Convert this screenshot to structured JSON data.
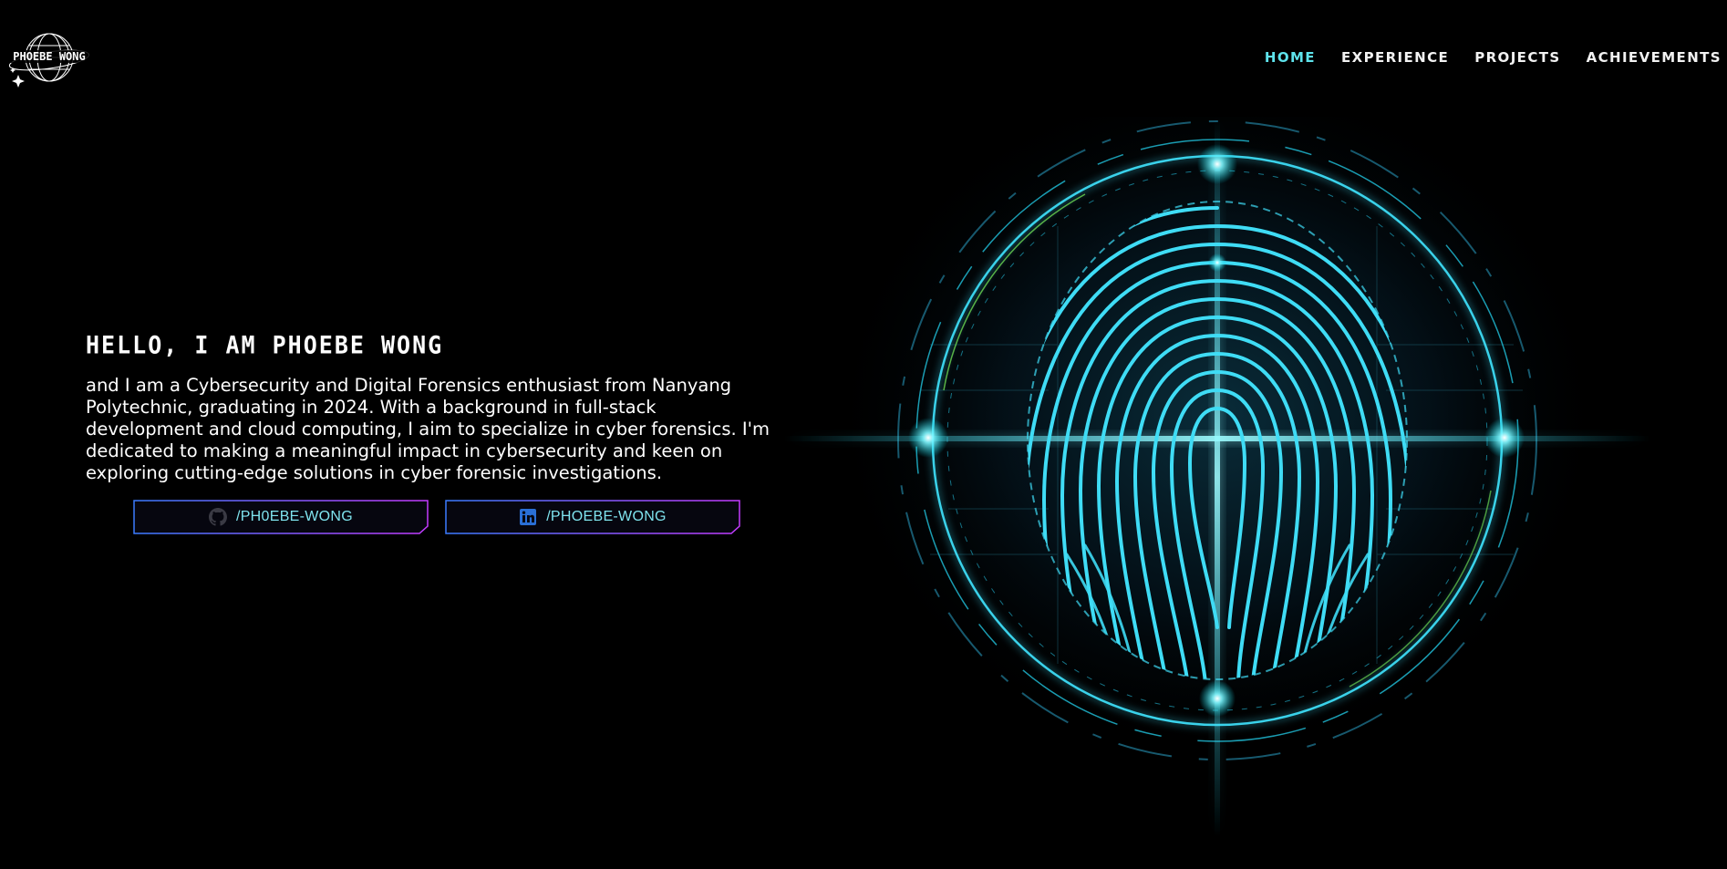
{
  "brand": {
    "logo_text": "PHOEBE WONG"
  },
  "nav": {
    "items": [
      {
        "label": "HOME",
        "active": true
      },
      {
        "label": "EXPERIENCE",
        "active": false
      },
      {
        "label": "PROJECTS",
        "active": false
      },
      {
        "label": "ACHIEVEMENTS",
        "active": false
      }
    ]
  },
  "hero": {
    "title": "HELLO, I AM PHOEBE WONG",
    "description": "and I am a Cybersecurity and Digital Forensics enthusiast from Nanyang Polytechnic, graduating in 2024. With a background in full-stack development and cloud computing, I aim to specialize in cyber forensics. I'm dedicated to making a meaningful impact in cybersecurity and keen on exploring cutting-edge solutions in cyber forensic investigations."
  },
  "socials": {
    "github": {
      "label": "/PH0EBE-WONG",
      "icon": "github-icon"
    },
    "linkedin": {
      "label": "/PHOEBE-WONG",
      "icon": "linkedin-icon"
    }
  },
  "colors": {
    "background": "#000000",
    "accent": "#5ee3ec",
    "button_border_start": "#3b7bff",
    "button_border_end": "#c33bff",
    "fingerprint_glow": "#22d6f0"
  }
}
